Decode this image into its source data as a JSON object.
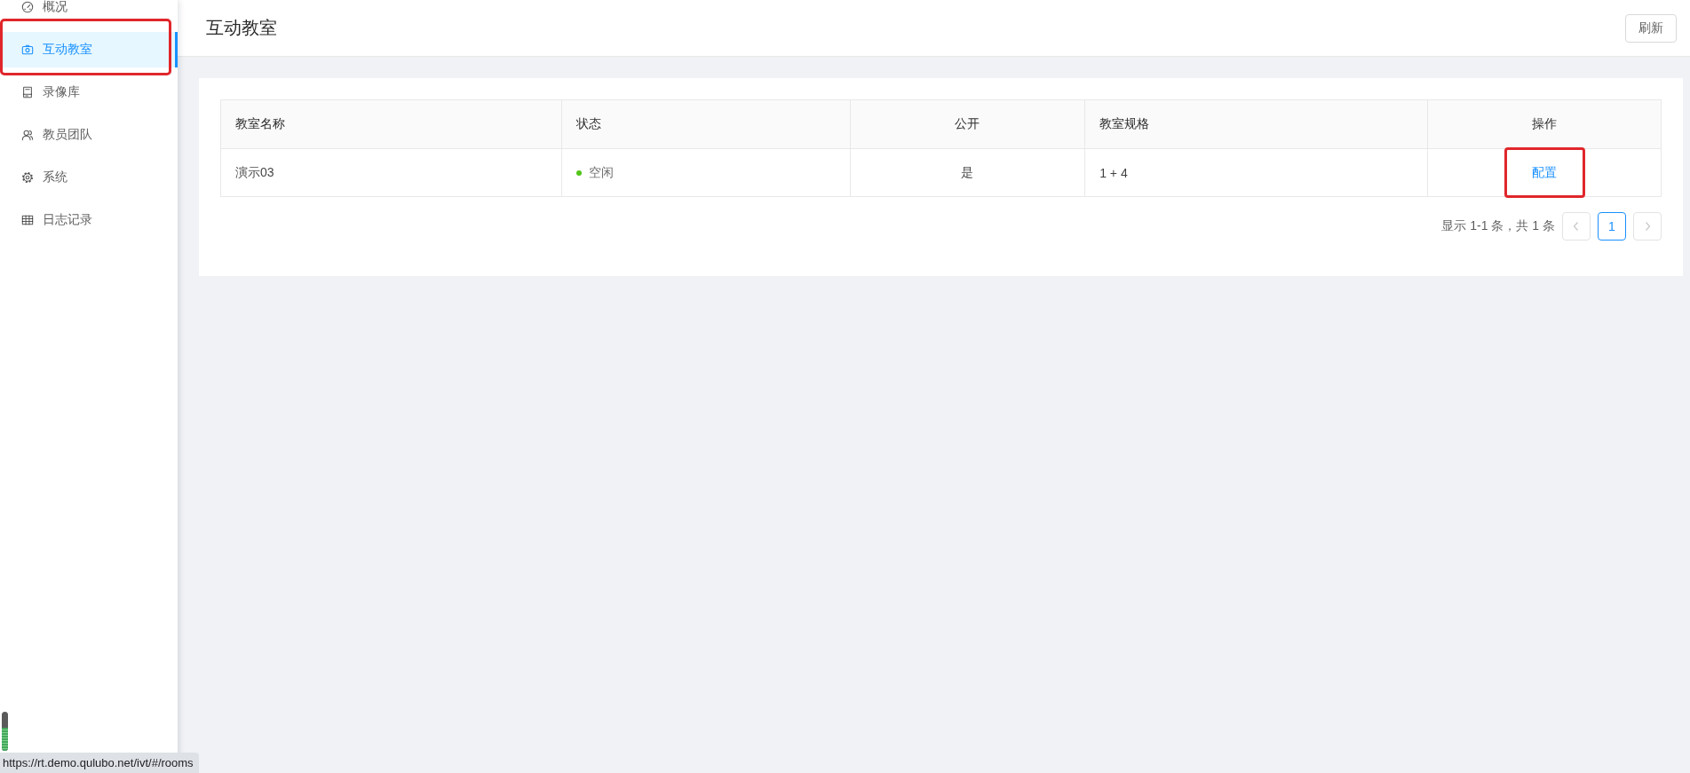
{
  "sidebar": {
    "items": [
      {
        "label": "概况",
        "selected": false,
        "annotated": false
      },
      {
        "label": "互动教室",
        "selected": true,
        "annotated": true
      },
      {
        "label": "录像库",
        "selected": false,
        "annotated": false
      },
      {
        "label": "教员团队",
        "selected": false,
        "annotated": false
      },
      {
        "label": "系统",
        "selected": false,
        "annotated": false
      },
      {
        "label": "日志记录",
        "selected": false,
        "annotated": false
      }
    ]
  },
  "header": {
    "title": "互动教室",
    "refresh_button": "刷新"
  },
  "table": {
    "columns": [
      "教室名称",
      "状态",
      "公开",
      "教室规格",
      "操作"
    ],
    "rows": [
      {
        "name": "演示03",
        "status": {
          "label": "空闲",
          "color": "#52c41a"
        },
        "public": "是",
        "spec": "1 + 4",
        "action": {
          "label": "配置",
          "annotated": true
        }
      }
    ]
  },
  "pagination": {
    "summary": "显示 1-1 条，共 1 条",
    "prev_disabled": true,
    "next_disabled": true,
    "pages": [
      {
        "label": "1",
        "selected": true
      }
    ]
  },
  "meter": {
    "level": 0.6
  },
  "status_bar": {
    "url": "https://rt.demo.qulubo.net/ivt/#/rooms"
  }
}
